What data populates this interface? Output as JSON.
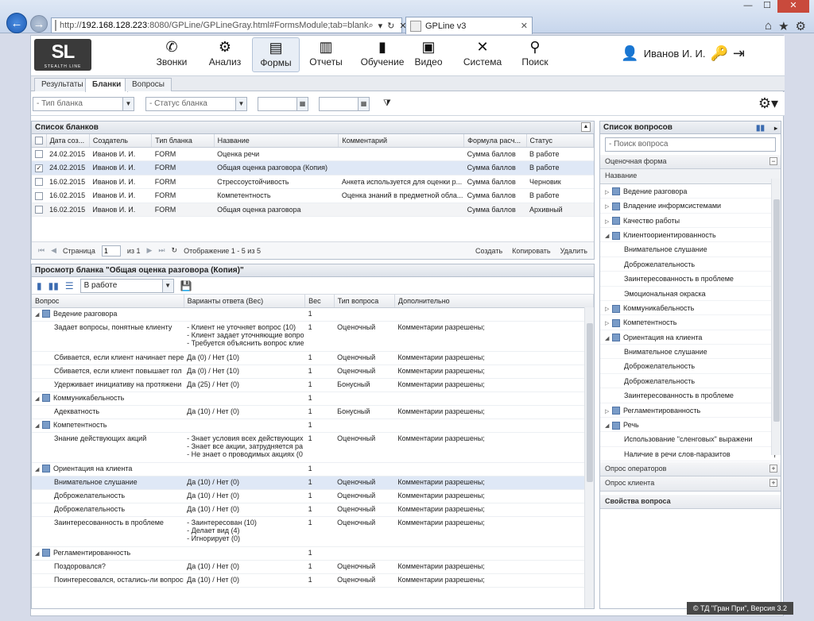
{
  "browser": {
    "url_prefix": "http://",
    "url_host": "192.168.128.223",
    "url_rest": ":8080/GPLine/GPLineGray.html#FormsModule;tab=blank",
    "tab_title": "GPLine v3",
    "window_min": "—",
    "window_max": "☐",
    "window_close": "✕"
  },
  "logo": {
    "text": "SL",
    "sub": "STEALTH LINE"
  },
  "menu": [
    {
      "label": "Звонки",
      "icon": "phone-icon"
    },
    {
      "label": "Анализ",
      "icon": "gears-icon"
    },
    {
      "label": "Формы",
      "icon": "form-icon"
    },
    {
      "label": "Отчеты",
      "icon": "chart-icon"
    },
    {
      "label": "Обучение",
      "icon": "book-icon"
    },
    {
      "label": "Видео",
      "icon": "film-icon"
    },
    {
      "label": "Система",
      "icon": "tools-icon"
    },
    {
      "label": "Поиск",
      "icon": "search-icon"
    }
  ],
  "user": {
    "name": "Иванов И. И."
  },
  "tabs": [
    "Результаты",
    "Бланки",
    "Вопросы"
  ],
  "filters": {
    "type_placeholder": "- Тип бланка",
    "status_placeholder": "- Статус бланка"
  },
  "blanks": {
    "title": "Список бланков",
    "columns": [
      "Дата соз...",
      "Создатель",
      "Тип бланка",
      "Название",
      "Комментарий",
      "Формула расч...",
      "Статус"
    ],
    "rows": [
      {
        "date": "24.02.2015",
        "creator": "Иванов И. И.",
        "type": "FORM",
        "name": "Оценка речи",
        "comment": "",
        "formula": "Сумма баллов",
        "status": "В работе",
        "checked": false
      },
      {
        "date": "24.02.2015",
        "creator": "Иванов И. И.",
        "type": "FORM",
        "name": "Общая оценка разговора (Копия)",
        "comment": "",
        "formula": "Сумма баллов",
        "status": "В работе",
        "checked": true
      },
      {
        "date": "16.02.2015",
        "creator": "Иванов И. И.",
        "type": "FORM",
        "name": "Стрессоустойчивость",
        "comment": "Анкета используется для оценки р...",
        "formula": "Сумма баллов",
        "status": "Черновик",
        "checked": false
      },
      {
        "date": "16.02.2015",
        "creator": "Иванов И. И.",
        "type": "FORM",
        "name": "Компетентность",
        "comment": "Оценка знаний в предметной обла...",
        "formula": "Сумма баллов",
        "status": "В работе",
        "checked": false
      },
      {
        "date": "16.02.2015",
        "creator": "Иванов И. И.",
        "type": "FORM",
        "name": "Общая оценка разговора",
        "comment": "",
        "formula": "Сумма баллов",
        "status": "Архивный",
        "checked": false
      }
    ],
    "pager": {
      "page_label": "Страница",
      "page": "1",
      "of": "из 1",
      "display": "Отображение 1 - 5 из 5",
      "create": "Создать",
      "copy": "Копировать",
      "delete": "Удалить"
    }
  },
  "preview": {
    "title": "Просмотр бланка \"Общая оценка разговора (Копия)\"",
    "status_value": "В работе",
    "columns": [
      "Вопрос",
      "Варианты ответа (Вес)",
      "Вес",
      "Тип вопроса",
      "Дополнительно"
    ],
    "rows": [
      {
        "group": true,
        "q": "Ведение разговора",
        "a": "",
        "w": "1",
        "t": "",
        "e": ""
      },
      {
        "group": false,
        "q": "Задает вопросы, понятные клиенту",
        "a": "- Клиент не уточняет вопрос (10)\n- Клиент задает уточняющие вопро\n- Требуется объяснить вопрос клие",
        "w": "1",
        "t": "Оценочный",
        "e": "Комментарии разрешены;"
      },
      {
        "group": false,
        "q": "Сбивается, если клиент начинает пере",
        "a": "Да (0) / Нет (10)",
        "w": "1",
        "t": "Оценочный",
        "e": "Комментарии разрешены;"
      },
      {
        "group": false,
        "q": "Сбивается, если клиент повышает гол",
        "a": "Да (0) / Нет (10)",
        "w": "1",
        "t": "Оценочный",
        "e": "Комментарии разрешены;"
      },
      {
        "group": false,
        "q": "Удерживает инициативу на протяжени",
        "a": "Да (25) / Нет (0)",
        "w": "1",
        "t": "Бонусный",
        "e": "Комментарии разрешены;"
      },
      {
        "group": true,
        "q": "Коммуникабельность",
        "a": "",
        "w": "1",
        "t": "",
        "e": ""
      },
      {
        "group": false,
        "q": "Адекватность",
        "a": "Да (10) / Нет (0)",
        "w": "1",
        "t": "Бонусный",
        "e": "Комментарии разрешены;"
      },
      {
        "group": true,
        "q": "Компетентность",
        "a": "",
        "w": "1",
        "t": "",
        "e": ""
      },
      {
        "group": false,
        "q": "Знание действующих акций",
        "a": "- Знает условия всех действующих\n- Знает все акции, затрудняется ра\n- Не знает о проводимых акциях (0",
        "w": "1",
        "t": "Оценочный",
        "e": "Комментарии разрешены;"
      },
      {
        "group": true,
        "q": "Ориентация на клиента",
        "a": "",
        "w": "1",
        "t": "",
        "e": ""
      },
      {
        "group": false,
        "sel": true,
        "q": "Внимательное слушание",
        "a": "Да (10) / Нет (0)",
        "w": "1",
        "t": "Оценочный",
        "e": "Комментарии разрешены;"
      },
      {
        "group": false,
        "q": "Доброжелательность",
        "a": "Да (10) / Нет (0)",
        "w": "1",
        "t": "Оценочный",
        "e": "Комментарии разрешены;"
      },
      {
        "group": false,
        "q": "Доброжелательность",
        "a": "Да (10) / Нет (0)",
        "w": "1",
        "t": "Оценочный",
        "e": "Комментарии разрешены;"
      },
      {
        "group": false,
        "q": "Заинтересованность в проблеме",
        "a": "- Заинтересован (10)\n- Делает вид (4)\n- Игнорирует (0)",
        "w": "1",
        "t": "Оценочный",
        "e": "Комментарии разрешены;"
      },
      {
        "group": true,
        "q": "Регламентированность",
        "a": "",
        "w": "1",
        "t": "",
        "e": ""
      },
      {
        "group": false,
        "q": "Поздоровался?",
        "a": "Да (10) / Нет (0)",
        "w": "1",
        "t": "Оценочный",
        "e": "Комментарии разрешены;"
      },
      {
        "group": false,
        "q": "Поинтересовался, остались-ли вопросы",
        "a": "Да (10) / Нет (0)",
        "w": "1",
        "t": "Оценочный",
        "e": "Комментарии разрешены;"
      }
    ]
  },
  "questions": {
    "title": "Список вопросов",
    "search_placeholder": "- Поиск вопроса",
    "section1": "Оценочная форма",
    "column": "Название",
    "tree": [
      {
        "level": 0,
        "label": "Ведение разговора",
        "open": false
      },
      {
        "level": 0,
        "label": "Владение информсистемами",
        "open": false
      },
      {
        "level": 0,
        "label": "Качество работы",
        "open": false
      },
      {
        "level": 0,
        "label": "Клиентоориентированность",
        "open": true
      },
      {
        "level": 1,
        "label": "Внимательное слушание"
      },
      {
        "level": 1,
        "label": "Доброжелательность"
      },
      {
        "level": 1,
        "label": "Заинтересованность в проблеме"
      },
      {
        "level": 1,
        "label": "Эмоциональная окраска"
      },
      {
        "level": 0,
        "label": "Коммуникабельность",
        "open": false
      },
      {
        "level": 0,
        "label": "Компетентность",
        "open": false
      },
      {
        "level": 0,
        "label": "Ориентация на клиента",
        "open": true
      },
      {
        "level": 1,
        "label": "Внимательное слушание"
      },
      {
        "level": 1,
        "label": "Доброжелательность"
      },
      {
        "level": 1,
        "label": "Доброжелательность"
      },
      {
        "level": 1,
        "label": "Заинтересованность в проблеме"
      },
      {
        "level": 0,
        "label": "Регламентированность",
        "open": false
      },
      {
        "level": 0,
        "label": "Речь",
        "open": true
      },
      {
        "level": 1,
        "label": "Использование \"сленговых\" выражени"
      },
      {
        "level": 1,
        "label": "Наличие в речи слов-паразитов"
      }
    ],
    "section2": "Опрос операторов",
    "section3": "Опрос клиента",
    "props_title": "Свойства вопроса"
  },
  "footer": "© ТД \"Гран При\", Версия 3.2",
  "colors": {
    "accent": "#1d5cb6",
    "selection": "#dfe8f6",
    "header_bg": "#e8ebef"
  }
}
